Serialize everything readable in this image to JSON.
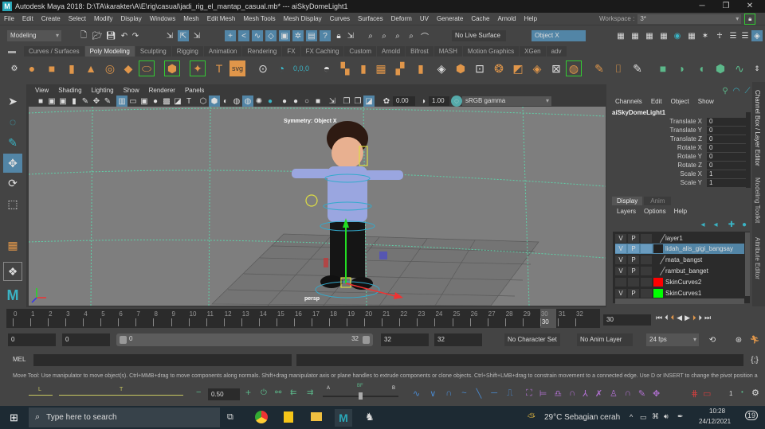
{
  "window": {
    "title": "Autodesk Maya 2018: D:\\TA\\karakter\\A\\E\\rig\\casual\\jadi_rig_el_mantap_casual.mb*   ---   aiSkyDomeLight1",
    "minimize": "─",
    "restore": "❐",
    "close": "✕"
  },
  "menubar": [
    "File",
    "Edit",
    "Create",
    "Select",
    "Modify",
    "Display",
    "Windows",
    "Mesh",
    "Edit Mesh",
    "Mesh Tools",
    "Mesh Display",
    "Curves",
    "Surfaces",
    "Deform",
    "UV",
    "Generate",
    "Cache",
    "Arnold",
    "Help"
  ],
  "workspace": {
    "label": "Workspace :",
    "value": "3*"
  },
  "statusline": {
    "menuset": "Modeling",
    "live_surface": "No Live Surface",
    "symmetry": "Object X"
  },
  "shelf": {
    "tabs": [
      "Curves / Surfaces",
      "Poly Modeling",
      "Sculpting",
      "Rigging",
      "Animation",
      "Rendering",
      "FX",
      "FX Caching",
      "Custom",
      "Arnold",
      "Bifrost",
      "MASH",
      "Motion Graphics",
      "XGen",
      "adv"
    ],
    "active": "Poly Modeling"
  },
  "viewport": {
    "menus": [
      "View",
      "Shading",
      "Lighting",
      "Show",
      "Renderer",
      "Panels"
    ],
    "exposure": "0.00",
    "gamma": "1.00",
    "colorspace": "sRGB gamma",
    "symmetry_label": "Symmetry: Object X",
    "camera": "persp"
  },
  "channelbox": {
    "menus": [
      "Channels",
      "Edit",
      "Object",
      "Show"
    ],
    "object": "aiSkyDomeLight1",
    "channels": [
      {
        "name": "Translate X",
        "value": "0"
      },
      {
        "name": "Translate Y",
        "value": "0"
      },
      {
        "name": "Translate Z",
        "value": "0"
      },
      {
        "name": "Rotate X",
        "value": "0"
      },
      {
        "name": "Rotate Y",
        "value": "0"
      },
      {
        "name": "Rotate Z",
        "value": "0"
      },
      {
        "name": "Scale X",
        "value": "1"
      },
      {
        "name": "Scale Y",
        "value": "1"
      }
    ]
  },
  "layereditor": {
    "tabs": [
      "Display",
      "Anim"
    ],
    "menus": [
      "Layers",
      "Options",
      "Help"
    ],
    "layers": [
      {
        "name": "layer1",
        "v": "V",
        "p": "P",
        "color": "",
        "selected": false
      },
      {
        "name": "lidah_alis_gigi_bangsay",
        "v": "V",
        "p": "P",
        "color": "",
        "selected": true
      },
      {
        "name": "mata_bangst",
        "v": "V",
        "p": "P",
        "color": "",
        "selected": false
      },
      {
        "name": "rambut_banget",
        "v": "V",
        "p": "P",
        "color": "",
        "selected": false
      },
      {
        "name": "SkinCurves2",
        "v": "",
        "p": "",
        "color": "#ff0000",
        "selected": false
      },
      {
        "name": "SkinCurves1",
        "v": "V",
        "p": "P",
        "color": "#00ff00",
        "selected": false
      }
    ]
  },
  "sidetabs": [
    "Channel Box / Layer Editor",
    "Modeling Toolkit",
    "Attribute Editor"
  ],
  "timeline": {
    "ticks": [
      "0",
      "1",
      "2",
      "3",
      "4",
      "5",
      "6",
      "7",
      "8",
      "9",
      "10",
      "11",
      "12",
      "13",
      "14",
      "15",
      "16",
      "17",
      "18",
      "19",
      "20",
      "21",
      "22",
      "23",
      "24",
      "25",
      "26",
      "27",
      "28",
      "29",
      "30",
      "31",
      "32"
    ],
    "current_frame": "30",
    "current_field": "30"
  },
  "range": {
    "start": "0",
    "anim_start": "0",
    "slider_start": "0",
    "slider_end": "32",
    "anim_end": "32",
    "end": "32",
    "character_set": "No Character Set",
    "anim_layer": "No Anim Layer",
    "fps": "24 fps"
  },
  "mel": {
    "label": "MEL"
  },
  "helpline": "Move Tool: Use manipulator to move object(s). Ctrl+MMB+drag to move components along normals. Shift+drag manipulator axis or plane handles to extrude components or clone objects. Ctrl+Shift+LMB+drag to constrain movement to a connected edge. Use D or INSERT to change the pivot position a",
  "bottombar": {
    "weight": "0.50",
    "label_L": "L",
    "label_T": "T",
    "label_A": "A",
    "label_BF": "BF",
    "label_B": "B",
    "count": "1"
  },
  "taskbar": {
    "search_placeholder": "Type here to search",
    "weather": "29°C  Sebagian cerah",
    "time": "10:28",
    "date": "24/12/2021",
    "notifications": "19"
  }
}
